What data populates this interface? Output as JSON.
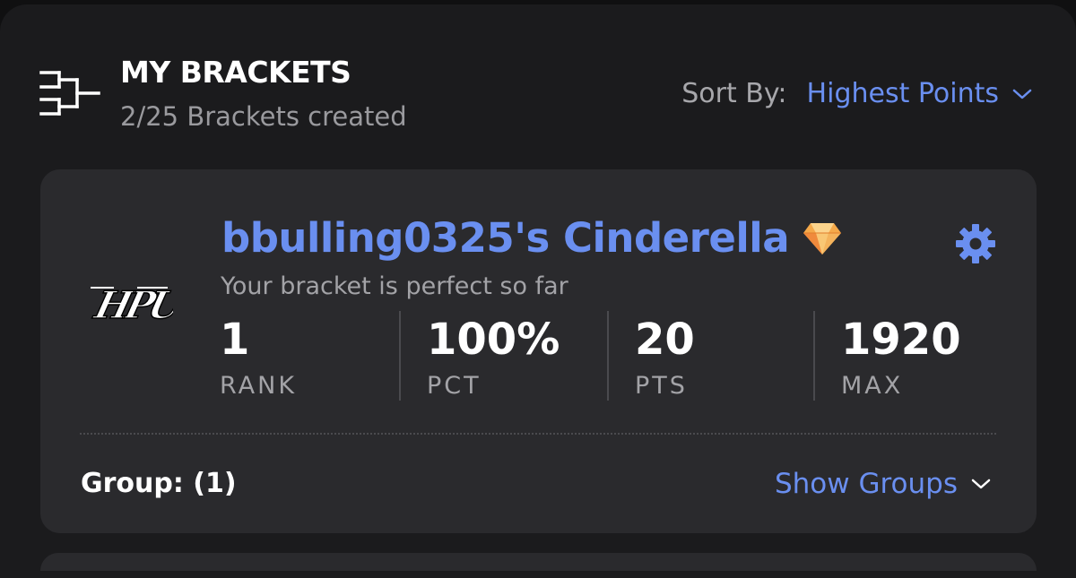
{
  "header": {
    "title": "MY BRACKETS",
    "subtitle": "2/25 Brackets created",
    "icon": "bracket-icon"
  },
  "sort": {
    "label": "Sort By:",
    "value": "Highest Points",
    "icon": "chevron-down-icon"
  },
  "bracket": {
    "name": "bbulling0325's Cinderella",
    "badge_icon": "diamond-icon",
    "settings_icon": "gear-icon",
    "team_logo": "HPU",
    "status": "Your bracket is perfect so far",
    "stats": [
      {
        "value": "1",
        "label": "RANK"
      },
      {
        "value": "100%",
        "label": "PCT"
      },
      {
        "value": "20",
        "label": "PTS"
      },
      {
        "value": "1920",
        "label": "MAX"
      }
    ],
    "group": "Group: (1)",
    "show_groups": "Show Groups"
  },
  "colors": {
    "background": "#101011",
    "panel": "#1b1b1d",
    "card": "#2a2a2d",
    "accent": "#6a8ff0",
    "muted_text": "#a3a3a7"
  }
}
